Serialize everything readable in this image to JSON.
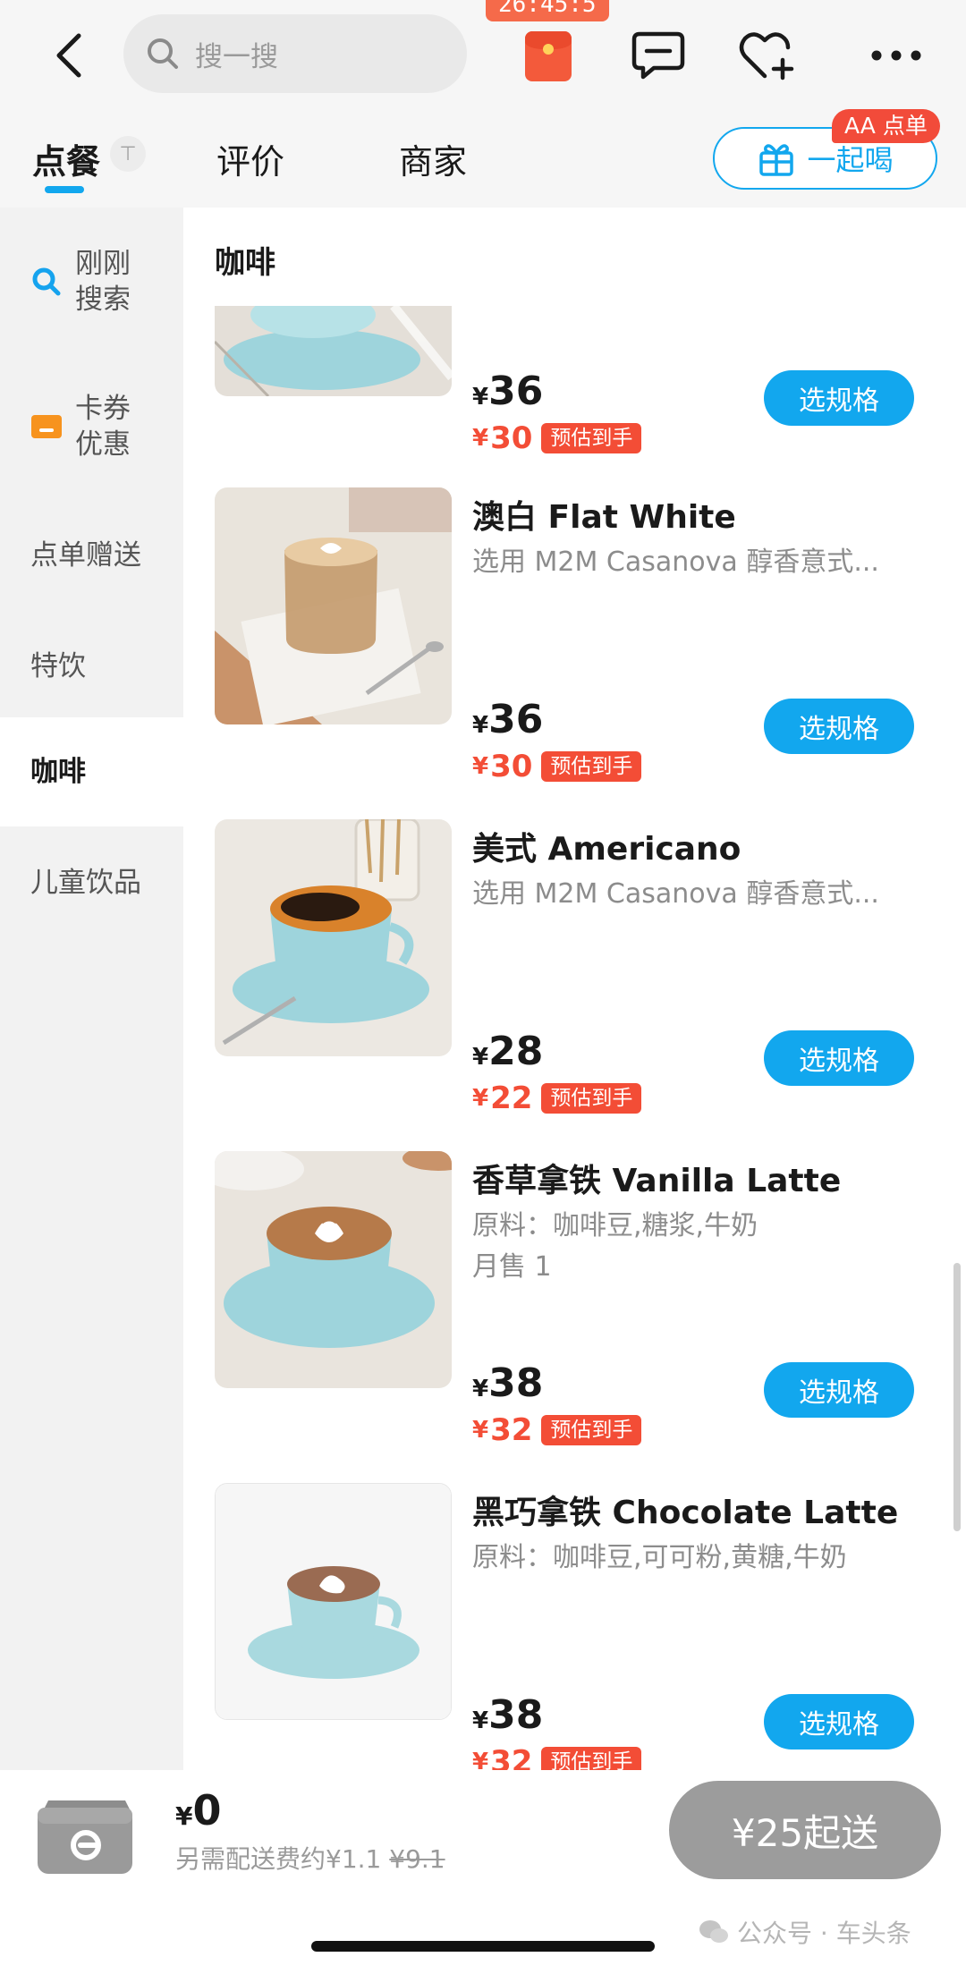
{
  "header": {
    "search_placeholder": "搜一搜",
    "timer": "26:45:5"
  },
  "tabs": {
    "items": [
      {
        "label": "点餐",
        "active": true
      },
      {
        "label": "评价",
        "active": false
      },
      {
        "label": "商家",
        "active": false
      }
    ],
    "pin_icon": "⊤",
    "together_label": "一起喝",
    "aa_badge": "AA 点单"
  },
  "sidebar": {
    "items": [
      {
        "label_line1": "刚刚",
        "label_line2": "搜索",
        "icon": "search-icon"
      },
      {
        "label_line1": "卡券",
        "label_line2": "优惠",
        "icon": "coupon-icon"
      },
      {
        "label": "点单赠送"
      },
      {
        "label": "特饮"
      },
      {
        "label": "咖啡",
        "active": true
      },
      {
        "label": "儿童饮品"
      }
    ]
  },
  "section": {
    "title": "咖啡"
  },
  "products": [
    {
      "name": "",
      "desc": "",
      "sales": "",
      "price_symbol": "¥",
      "price": "36",
      "deal_symbol": "¥",
      "deal_price": "30",
      "deal_tag": "预估到手",
      "button": "选规格"
    },
    {
      "name": "澳白 Flat White",
      "desc": "选用 M2M Casanova 醇香意式...",
      "sales": "",
      "price_symbol": "¥",
      "price": "36",
      "deal_symbol": "¥",
      "deal_price": "30",
      "deal_tag": "预估到手",
      "button": "选规格"
    },
    {
      "name": "美式 Americano",
      "desc": "选用 M2M Casanova 醇香意式...",
      "sales": "",
      "price_symbol": "¥",
      "price": "28",
      "deal_symbol": "¥",
      "deal_price": "22",
      "deal_tag": "预估到手",
      "button": "选规格"
    },
    {
      "name": "香草拿铁 Vanilla Latte",
      "desc": "原料：咖啡豆,糖浆,牛奶",
      "sales": "月售 1",
      "price_symbol": "¥",
      "price": "38",
      "deal_symbol": "¥",
      "deal_price": "32",
      "deal_tag": "预估到手",
      "button": "选规格"
    },
    {
      "name": "黑巧拿铁 Chocolate Latte",
      "desc": "原料：咖啡豆,可可粉,黄糖,牛奶",
      "sales": "",
      "price_symbol": "¥",
      "price": "38",
      "deal_symbol": "¥",
      "deal_price": "32",
      "deal_tag": "预估到手",
      "button": "选规格"
    }
  ],
  "cart": {
    "price_symbol": "¥",
    "total": "0",
    "delivery_text": "另需配送费约¥1.1",
    "delivery_original": "¥9.1",
    "min_order": "¥25起送"
  },
  "watermark": "公众号 · 车头条",
  "colors": {
    "accent": "#12a7ee",
    "deal": "#f34d36",
    "disabled": "#9c9c9c"
  }
}
